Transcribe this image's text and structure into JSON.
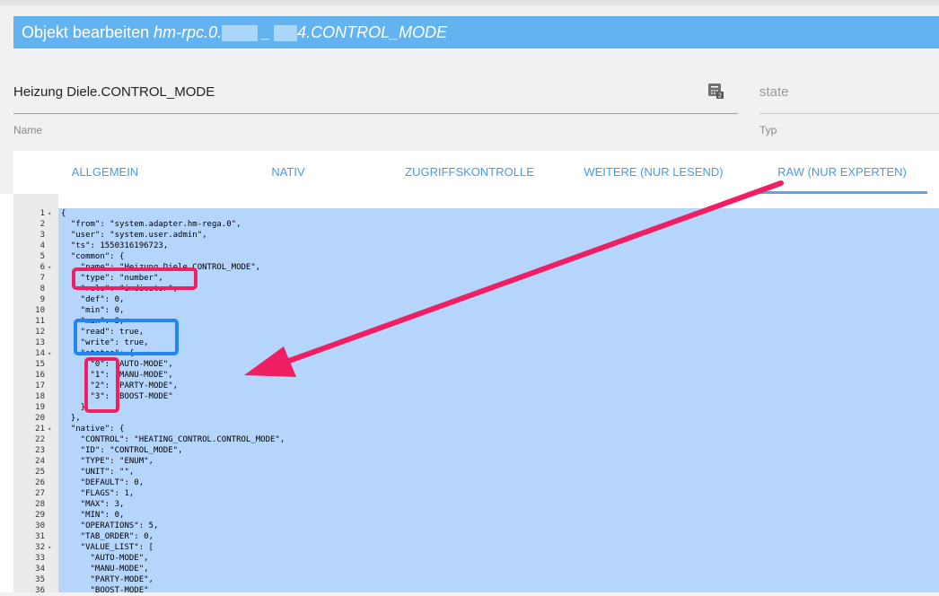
{
  "dialog": {
    "title_prefix": "Objekt bearbeiten",
    "title_object_start": "hm-rpc.0.",
    "title_object_sep": "_",
    "title_object_end": "4.CONTROL_MODE"
  },
  "fields": {
    "name_value": "Heizung Diele.CONTROL_MODE",
    "name_label": "Name",
    "name_icon": "calculator-icon",
    "type_value": "state",
    "type_label": "Typ"
  },
  "tabs": [
    {
      "label": "ALLGEMEIN"
    },
    {
      "label": "NATIV"
    },
    {
      "label": "ZUGRIFFSKONTROLLE"
    },
    {
      "label": "WEITERE (NUR LESEND)"
    },
    {
      "label": "RAW (NUR EXPERTEN)",
      "active": true
    }
  ],
  "editor": {
    "lines": [
      {
        "n": "1",
        "fold": true,
        "code": "{"
      },
      {
        "n": "2",
        "code": "  \"from\": \"system.adapter.hm-rega.0\","
      },
      {
        "n": "3",
        "code": "  \"user\": \"system.user.admin\","
      },
      {
        "n": "4",
        "code": "  \"ts\": 1550316196723,"
      },
      {
        "n": "5",
        "code": "  \"common\": {"
      },
      {
        "n": "6",
        "fold": true,
        "code": "    \"name\": \"Heizung Diele.CONTROL_MODE\","
      },
      {
        "n": "7",
        "code": "    \"type\": \"number\","
      },
      {
        "n": "8",
        "code": "    \"role\": \"indicator\","
      },
      {
        "n": "9",
        "code": "    \"def\": 0,"
      },
      {
        "n": "10",
        "code": "    \"min\": 0,"
      },
      {
        "n": "11",
        "code": "    \"max\": 3,"
      },
      {
        "n": "12",
        "code": "    \"read\": true,"
      },
      {
        "n": "13",
        "code": "    \"write\": true,"
      },
      {
        "n": "14",
        "fold": true,
        "code": "    \"states\": {"
      },
      {
        "n": "15",
        "code": "      \"0\": \"AUTO-MODE\","
      },
      {
        "n": "16",
        "code": "      \"1\": \"MANU-MODE\","
      },
      {
        "n": "17",
        "code": "      \"2\": \"PARTY-MODE\","
      },
      {
        "n": "18",
        "code": "      \"3\": \"BOOST-MODE\""
      },
      {
        "n": "19",
        "code": "    }"
      },
      {
        "n": "20",
        "code": "  },"
      },
      {
        "n": "21",
        "fold": true,
        "code": "  \"native\": {"
      },
      {
        "n": "22",
        "code": "    \"CONTROL\": \"HEATING_CONTROL.CONTROL_MODE\","
      },
      {
        "n": "23",
        "code": "    \"ID\": \"CONTROL_MODE\","
      },
      {
        "n": "24",
        "code": "    \"TYPE\": \"ENUM\","
      },
      {
        "n": "25",
        "code": "    \"UNIT\": \"\","
      },
      {
        "n": "26",
        "code": "    \"DEFAULT\": 0,"
      },
      {
        "n": "27",
        "code": "    \"FLAGS\": 1,"
      },
      {
        "n": "28",
        "code": "    \"MAX\": 3,"
      },
      {
        "n": "29",
        "code": "    \"MIN\": 0,"
      },
      {
        "n": "30",
        "code": "    \"OPERATIONS\": 5,"
      },
      {
        "n": "31",
        "code": "    \"TAB_ORDER\": 0,"
      },
      {
        "n": "32",
        "fold": true,
        "code": "    \"VALUE_LIST\": ["
      },
      {
        "n": "33",
        "code": "      \"AUTO-MODE\","
      },
      {
        "n": "34",
        "code": "      \"MANU-MODE\","
      },
      {
        "n": "35",
        "code": "      \"PARTY-MODE\","
      },
      {
        "n": "36",
        "code": "      \"BOOST-MODE\""
      }
    ]
  },
  "colors": {
    "title_bar": "#63b3f1",
    "tab_text": "#4b9be0",
    "selection": "#b5d5fb",
    "highlight_pink": "#ee1f63",
    "highlight_blue": "#2485f0"
  }
}
